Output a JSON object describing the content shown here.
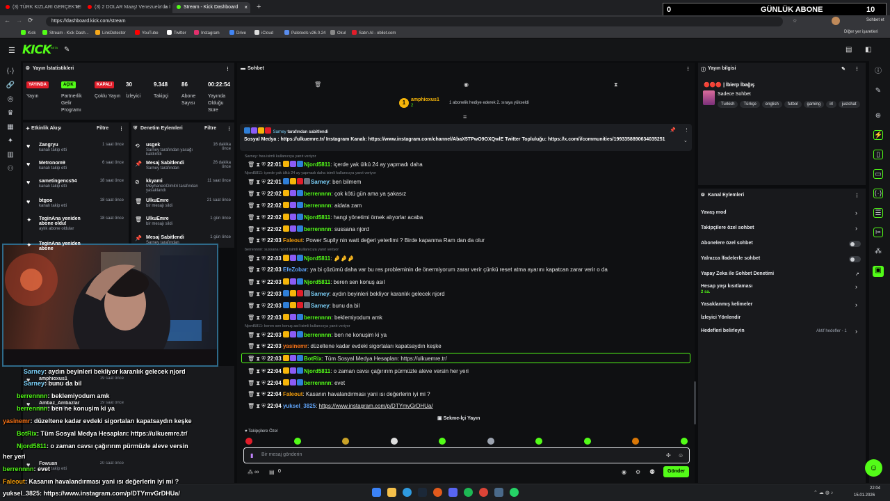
{
  "browser": {
    "tabs": [
      {
        "label": "(3) TÜRK KIZLARI GERÇEKTEN \"KE...",
        "color": "#ff0000"
      },
      {
        "label": "(3) 2 DOLAR Maaş! Venezuela'da İl...",
        "color": "#ff0000"
      },
      {
        "label": "Stream - Kick Dashboard",
        "color": "#53fc18",
        "active": true
      }
    ],
    "url": "https://dashboard.kick.com/stream",
    "profile_label": "Sohbet et",
    "bookmarks": [
      "Kick",
      "Stream - Kick Dash...",
      "LinkDetector",
      "YouTube",
      "Twitter",
      "Instagram",
      "Drive",
      "iCloud",
      "Paletools v26.0.24",
      "Okul",
      "Satın Al - obilet.com"
    ],
    "bookmarks_right": "Diğer yer işaretleri",
    "abone": {
      "left": "0",
      "label": "GÜNLÜK ABONE",
      "right": "10"
    }
  },
  "header": {
    "logo": "KICK",
    "logo_sup": "BETA"
  },
  "stats": {
    "title": "Yayın İstatistikleri",
    "status": [
      {
        "badge": "YAYINDA",
        "label": "Yayın",
        "color": "#e11d2a"
      },
      {
        "badge": "AÇIK",
        "label": "Partnerlik Gelir Programı",
        "color": "#53fc18"
      },
      {
        "badge": "KAPALI",
        "label": "Çoklu Yayın",
        "color": "#e11d2a"
      }
    ],
    "metrics": [
      {
        "value": "30",
        "label": "İzleyici"
      },
      {
        "value": "9.348",
        "label": "Takipçi"
      },
      {
        "value": "86",
        "label": "Abone Sayısı"
      },
      {
        "value": "00:22:54",
        "label": "Yayında Olduğu Süre"
      }
    ]
  },
  "activity": {
    "title": "Etkinlik Akışı",
    "filter": "Filtre",
    "items": [
      {
        "name": "Zangryu",
        "desc": "kanalı takip etti",
        "time": "1 saat önce"
      },
      {
        "name": "Metronom9",
        "desc": "kanalı takip etti",
        "time": "6 saat önce"
      },
      {
        "name": "sametingencs54",
        "desc": "kanalı takip etti",
        "time": "18 saat önce"
      },
      {
        "name": "btgoo",
        "desc": "kanalı takip etti",
        "time": "18 saat önce"
      },
      {
        "name": "TeginAna yeniden abone oldu!",
        "desc": "aylık abone oldular",
        "time": "18 saat önce"
      },
      {
        "name": "TeginAna yeniden abone",
        "desc": "",
        "time": ""
      }
    ],
    "lower": [
      {
        "name": "amphioxus1",
        "desc": "aylık abonelik",
        "time": "19 saat önce"
      },
      {
        "name": "Ambaz_Ambazlar",
        "desc": "kanalı takip etti",
        "time": "19 saat önce"
      },
      {
        "name": "Fowuan",
        "desc": "kanalı takip etti",
        "time": "20 saat önce"
      }
    ]
  },
  "moderation": {
    "title": "Denetim Eylemleri",
    "filter": "Filtre",
    "items": [
      {
        "name": "usgek",
        "desc": "Sarney tarafından yasağı kaldırıldı",
        "time": "16 dakika önce"
      },
      {
        "name": "Mesaj Sabitlendi",
        "desc": "Sarney tarafından",
        "time": "26 dakika önce"
      },
      {
        "name": "kkyami",
        "desc": "MeyhaneciDimitri tarafından yasaklandı",
        "time": "11 saat önce"
      },
      {
        "name": "UlkuEmre",
        "desc": "bir mesajı sildi",
        "time": "21 saat önce"
      },
      {
        "name": "UlkuEmre",
        "desc": "bir mesajı sildi",
        "time": "1 gün önce"
      },
      {
        "name": "Mesaj Sabitlendi",
        "desc": "Sarney tarafından",
        "time": "1 gün önce"
      }
    ]
  },
  "chat": {
    "title": "Sohbet",
    "gift": {
      "user": "amphioxus1",
      "count": "2",
      "text": "1 abonelik hediye ederek 2. sıraya yükseldi"
    },
    "pinned": {
      "by": "Sarney",
      "by_suffix": "tarafından sabitlendi",
      "text": "Sosyal Medya : https://ulkuemre.tr/ Instagram Kanalı: https://www.instagram.com/channel/AbaX5TPwO9OXQwlE Twitter Topluluğu: https://x.com/i/communities/1993358890634035251"
    },
    "messages": [
      {
        "reply": "Sarney: hea isimli kullanıcıya yanıt veriyor",
        "time": "22:01",
        "user": "Njord5811",
        "color": "#53fc18",
        "text": "içerde yak ülkü 24 ay yapmadı daha"
      },
      {
        "reply": "Njord5811: içerde yak ülkü 24 ay yapmadı daha isimli kullanıcıya yanıt veriyor",
        "time": "22:01",
        "user": "Sarney",
        "color": "#7dd3fc",
        "text": "ben bilmem"
      },
      {
        "time": "22:02",
        "user": "berrennnn",
        "color": "#53fc18",
        "text": "çok kötü gün ama ya şakasız"
      },
      {
        "time": "22:02",
        "user": "berrennnn",
        "color": "#53fc18",
        "text": "aidata zam"
      },
      {
        "time": "22:02",
        "user": "Njord5811",
        "color": "#53fc18",
        "text": "hangi yönetimi örnek alıyorlar acaba"
      },
      {
        "time": "22:02",
        "user": "berrennnn",
        "color": "#53fc18",
        "text": "sussana njord"
      },
      {
        "time": "22:03",
        "user": "Faleout",
        "color": "#f59e0b",
        "text": "Power Suplly nin watt değeri yeterlimi ? Birde kapanma Ram dan da olur"
      },
      {
        "reply": "berrennnn: sussana njord isimli kullanıcıya yanıt veriyor",
        "time": "22:03",
        "user": "Njord5811",
        "color": "#53fc18",
        "text": "🤌🤌🤌"
      },
      {
        "time": "22:03",
        "user": "EfeZobar",
        "color": "#60a5fa",
        "text": "ya bi çözümü daha var bu res probleminin de önermiyorum zarar verir çünkü reset atma ayarını kapatcan zarar verir o da"
      },
      {
        "time": "22:03",
        "user": "Njord5811",
        "color": "#53fc18",
        "text": "beren sen konuş asıl"
      },
      {
        "time": "22:03",
        "user": "Sarney",
        "color": "#7dd3fc",
        "text": "aydın beyinleri bekliyor karanlık gelecek njord"
      },
      {
        "time": "22:03",
        "user": "Sarney",
        "color": "#7dd3fc",
        "text": "bunu da bil"
      },
      {
        "time": "22:03",
        "user": "berrennnn",
        "color": "#53fc18",
        "text": "beklemiyodum amk"
      },
      {
        "reply": "Njord5811: beren sen konuş asıl isimli kullanıcıya yanıt veriyor",
        "time": "22:03",
        "user": "berrennnn",
        "color": "#53fc18",
        "text": "ben ne konuşim ki ya"
      },
      {
        "time": "22:03",
        "user": "yasinemr",
        "color": "#f97316",
        "text": "düzeltene kadar evdeki sigortaları kapatsaydın keşke"
      },
      {
        "time": "22:03",
        "user": "BotRix",
        "color": "#53fc18",
        "text": "Tüm Sosyal Medya Hesapları: https://ulkuemre.tr/",
        "highlight": true
      },
      {
        "time": "22:04",
        "user": "Njord5811",
        "color": "#53fc18",
        "text": "o zaman cavsı çağırırım pürmüzle aleve versin her yeri"
      },
      {
        "time": "22:04",
        "user": "berrennnn",
        "color": "#53fc18",
        "text": "evet"
      },
      {
        "time": "22:04",
        "user": "Faleout",
        "color": "#f59e0b",
        "text": "Kasanın havalandırması yani ısı değerlerin iyi mi ?"
      },
      {
        "time": "22:04",
        "user": "yuksel_3825",
        "color": "#60a5fa",
        "text": "https://www.instagram.com/p/DTYmvGrDHUa/"
      }
    ],
    "tab_label": "Sekme-İçi Yayın",
    "emote_label": "Takipçilere Özel",
    "input_placeholder": "Bir mesaj gönderin",
    "send": "Gönder",
    "points": "0",
    "infinity": "∞"
  },
  "overlay": [
    {
      "user": "Sarney",
      "color": "#7dd3fc",
      "text": "aydın beyinleri bekliyor karanlık gelecek njord"
    },
    {
      "user": "Sarney",
      "color": "#7dd3fc",
      "text": "bunu da bil"
    },
    {
      "user": "berrennnn",
      "color": "#53fc18",
      "text": "beklemiyodum amk"
    },
    {
      "user": "berrennnn",
      "color": "#53fc18",
      "text": "ben ne konuşim ki ya"
    },
    {
      "user": "yasinemr",
      "color": "#f97316",
      "text": "düzeltene kadar evdeki sigortaları kapatsaydın keşke"
    },
    {
      "user": "BotRix",
      "color": "#53fc18",
      "text": "Tüm Sosyal Medya Hesapları: https://ulkuemre.tr/"
    },
    {
      "user": "Njord5811",
      "color": "#53fc18",
      "text": "o zaman cavsı çağırırım pürmüzle aleve versin"
    },
    {
      "user": "",
      "color": "#fff",
      "text": "her yeri"
    },
    {
      "user": "berrennnn",
      "color": "#53fc18",
      "text": "evet"
    },
    {
      "user": "Faleout",
      "color": "#f59e0b",
      "text": "Kasanın havalandırması yani ısı değerlerin iyi mi ?"
    },
    {
      "user": "yuksel_3825",
      "color": "#fff",
      "text": "https://www.instagram.com/p/DTYmvGrDHUa/"
    }
  ],
  "info": {
    "title": "Yayın bilgisi",
    "stream_title": "🔴🔴🔴 | İbierp İbağış",
    "category": "Sadece Sohbet",
    "tags": [
      "Turkish",
      "Türkçe",
      "english",
      "futbol",
      "gaming",
      "irl",
      "justchat"
    ]
  },
  "channel": {
    "title": "Kanal Eylemleri",
    "actions": [
      {
        "label": "Yavaş mod",
        "kind": "chevron"
      },
      {
        "label": "Takipçilere özel sohbet",
        "kind": "chevron"
      },
      {
        "label": "Abonelere özel sohbet",
        "kind": "toggle"
      },
      {
        "label": "Yalnızca İfadelerle sohbet",
        "kind": "toggle"
      },
      {
        "label": "Yapay Zeka ile Sohbet Denetimi",
        "kind": "link"
      },
      {
        "label": "Hesap yaşı kısıtlaması",
        "sub": "2 sa.",
        "kind": "chevron"
      },
      {
        "label": "Yasaklanmış kelimeler",
        "kind": "chevron"
      },
      {
        "label": "İzleyici Yönlendir",
        "kind": "none"
      },
      {
        "label": "Hedefleri belirleyin",
        "extra": "Aktif hedefler - 1",
        "kind": "chevron"
      }
    ]
  },
  "taskbar": {
    "time": "22:04",
    "date": "15.01.2026"
  }
}
